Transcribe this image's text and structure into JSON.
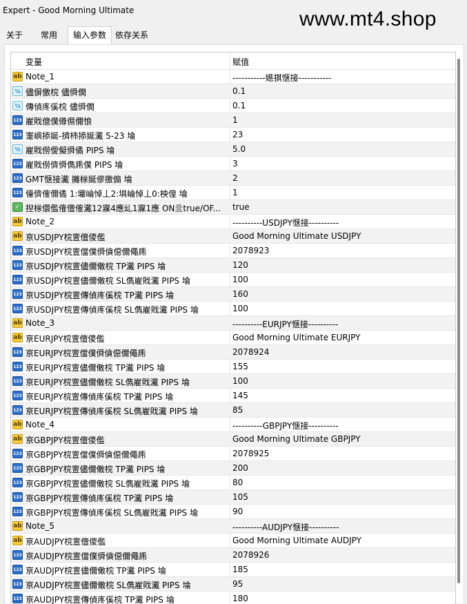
{
  "window": {
    "title": "Expert - Good Morning Ultimate"
  },
  "watermark": "www.mt4.shop",
  "tabs": [
    {
      "label": "关于",
      "active": false
    },
    {
      "label": "常用",
      "active": false
    },
    {
      "label": "输入参数",
      "active": true
    },
    {
      "label": "依存关系",
      "active": false
    }
  ],
  "grid": {
    "header": {
      "variable": "变量",
      "value": "赋值"
    },
    "rows": [
      {
        "icon": "ab",
        "name": "Note_1",
        "value": "-----------嬨掑惬接-----------"
      },
      {
        "icon": "half",
        "name": "儘偋儌梡 儘僢僩",
        "value": "0.1"
      },
      {
        "icon": "half",
        "name": "傳偵庝傒梡 儘僢僩",
        "value": "0.1"
      },
      {
        "icon": "123",
        "name": "嵟戝億僕僔儑儞悢",
        "value": "1"
      },
      {
        "icon": "123",
        "name": "寁嶼掭娫-擠柿掭娫瀻 5-23 埨",
        "value": "23"
      },
      {
        "icon": "half",
        "name": "嵟戝僗僾儗僢僪 PIPS 埨",
        "value": "5.0"
      },
      {
        "icon": "123",
        "name": "嵟戝僗儕僢儁乕僕 PIPS 埨",
        "value": "3"
      },
      {
        "icon": "123",
        "name": "GMT惬接瀻 攡柡娫傪撽傓 埨",
        "value": "2"
      },
      {
        "icon": "123",
        "name": "儓儕傕儞僪 1:壧崘悼丄2:埧崘悼丄0:柍偟 埨",
        "value": "1"
      },
      {
        "icon": "bool",
        "name": "揑柡儇儖傕儃傕瀻12寱4應乣1寱1應 ON亖true/OF...",
        "value": "true"
      },
      {
        "icon": "ab",
        "name": "Note_2",
        "value": "----------USDJPY惬接----------"
      },
      {
        "icon": "ab",
        "name": "亰USDJPY梡亶儃儍儖",
        "value": "Good Morning Ultimate USDJPY"
      },
      {
        "icon": "123",
        "name": "亰USDJPY梡亶儅僕僢僋僫儞僶乕",
        "value": "2078923"
      },
      {
        "icon": "123",
        "name": "亰USDJPY梡亶儘儞僌梡 TP瀻 PIPS 埨",
        "value": "120"
      },
      {
        "icon": "123",
        "name": "亰USDJPY梡亶儘儞僌梡 SL儁嵟戝瀻 PIPS 埨",
        "value": "100"
      },
      {
        "icon": "123",
        "name": "亰USDJPY梡亶傳偵庝傒梡 TP瀻 PIPS 埨",
        "value": "160"
      },
      {
        "icon": "123",
        "name": "亰USDJPY梡亶傳偵庝傒梡 SL儁嵟戝瀻 PIPS 埨",
        "value": "100"
      },
      {
        "icon": "ab",
        "name": "Note_3",
        "value": "----------EURJPY惬接----------"
      },
      {
        "icon": "ab",
        "name": "亰EURJPY梡亶儃儍儖",
        "value": "Good Morning Ultimate EURJPY"
      },
      {
        "icon": "123",
        "name": "亰EURJPY梡亶儅僕僢僋僫儞僶乕",
        "value": "2078924"
      },
      {
        "icon": "123",
        "name": "亰EURJPY梡亶儘儞僌梡 TP瀻 PIPS 埨",
        "value": "155"
      },
      {
        "icon": "123",
        "name": "亰EURJPY梡亶儘儞僌梡 SL儁嵟戝瀻 PIPS 埨",
        "value": "100"
      },
      {
        "icon": "123",
        "name": "亰EURJPY梡亶傳偵庝傒梡 TP瀻 PIPS 埨",
        "value": "145"
      },
      {
        "icon": "123",
        "name": "亰EURJPY梡亶傳偵庝傒梡 SL儁嵟戝瀻 PIPS 埨",
        "value": "85"
      },
      {
        "icon": "ab",
        "name": "Note_4",
        "value": "----------GBPJPY惬接----------"
      },
      {
        "icon": "ab",
        "name": "亰GBPJPY梡亶儃儍儖",
        "value": "Good Morning Ultimate GBPJPY"
      },
      {
        "icon": "123",
        "name": "亰GBPJPY梡亶儅僕僢僋僫儞僶乕",
        "value": "2078925"
      },
      {
        "icon": "123",
        "name": "亰GBPJPY梡亶儘儞僌梡 TP瀻 PIPS 埨",
        "value": "200"
      },
      {
        "icon": "123",
        "name": "亰GBPJPY梡亶儘儞僌梡 SL儁嵟戝瀻 PIPS 埨",
        "value": "80"
      },
      {
        "icon": "123",
        "name": "亰GBPJPY梡亶傳偵庝傒梡 TP瀻 PIPS 埨",
        "value": "105"
      },
      {
        "icon": "123",
        "name": "亰GBPJPY梡亶傳偵庝傒梡 SL儁嵟戝瀻 PIPS 埨",
        "value": "90"
      },
      {
        "icon": "ab",
        "name": "Note_5",
        "value": "----------AUDJPY惬接----------"
      },
      {
        "icon": "ab",
        "name": "亰AUDJPY梡亶儃儍儖",
        "value": "Good Morning Ultimate AUDJPY"
      },
      {
        "icon": "123",
        "name": "亰AUDJPY梡亶儅僕僢僋僫儞僶乕",
        "value": "2078926"
      },
      {
        "icon": "123",
        "name": "亰AUDJPY梡亶儘儞僌梡 TP瀻 PIPS 埨",
        "value": "185"
      },
      {
        "icon": "123",
        "name": "亰AUDJPY梡亶儘儞僌梡 SL儁嵟戝瀻 PIPS 埨",
        "value": "95"
      },
      {
        "icon": "123",
        "name": "亰AUDJPY梡亶傳偵庝傒梡 TP瀻 PIPS 埨",
        "value": "180"
      }
    ]
  },
  "icon_labels": {
    "ab": "ab",
    "123": "123",
    "half": "½",
    "bool": "✓"
  }
}
